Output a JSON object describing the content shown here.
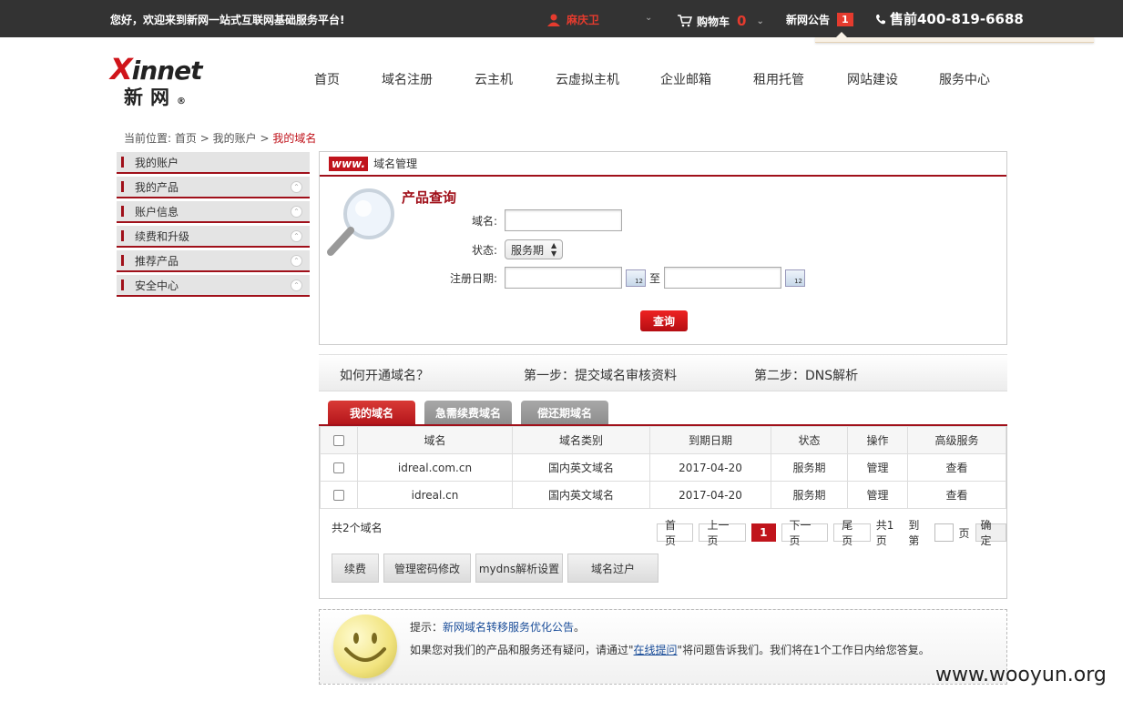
{
  "topbar": {
    "welcome": "您好，欢迎来到新网一站式互联网基础服务平台!",
    "user_name": "麻庆卫",
    "cart_label": "购物车",
    "cart_count": "0",
    "notice_label": "新网公告",
    "notice_count": "1",
    "phone": "售前400-819-6688"
  },
  "logo": {
    "en_x": "X",
    "en_rest": "innet",
    "cn": "新网",
    "reg": "®"
  },
  "nav": [
    "首页",
    "域名注册",
    "云主机",
    "云虚拟主机",
    "企业邮箱",
    "租用托管",
    "网站建设",
    "服务中心"
  ],
  "breadcrumb": {
    "prefix": "当前位置:",
    "home": "首页",
    "sep1": ">",
    "account": "我的账户",
    "sep2": ">",
    "current": "我的域名"
  },
  "sidebar": [
    "我的账户",
    "我的产品",
    "账户信息",
    "续费和升级",
    "推荐产品",
    "安全中心"
  ],
  "panel": {
    "www_badge": "www.",
    "title": "域名管理",
    "query_title": "产品查询",
    "domain_label": "域名:",
    "status_label": "状态:",
    "status_value": "服务期",
    "date_label": "注册日期:",
    "date_sep": "至",
    "calendar_day": "12",
    "search_btn": "查询"
  },
  "howto": {
    "question": "如何开通域名？",
    "step1": "第一步：提交域名审核资料",
    "step2": "第二步：DNS解析"
  },
  "tabs": [
    "我的域名",
    "急需续费域名",
    "偿还期域名"
  ],
  "table": {
    "headers": [
      "域名",
      "域名类别",
      "到期日期",
      "状态",
      "操作",
      "高级服务"
    ],
    "rows": [
      [
        "idreal.com.cn",
        "国内英文域名",
        "2017-04-20",
        "服务期",
        "管理",
        "查看"
      ],
      [
        "idreal.cn",
        "国内英文域名",
        "2017-04-20",
        "服务期",
        "管理",
        "查看"
      ]
    ]
  },
  "pager": {
    "total": "共2个域名",
    "first": "首页",
    "prev": "上一页",
    "current": "1",
    "next": "下一页",
    "last": "尾页",
    "pages_total": "共1页",
    "goto_prefix": "到第",
    "goto_suffix": "页",
    "confirm": "确定"
  },
  "actions": [
    "续费",
    "管理密码修改",
    "mydns解析设置",
    "域名过户"
  ],
  "tip": {
    "prefix": "提示：",
    "link": "新网域名转移服务优化公告",
    "end": "。",
    "line2_a": "如果您对我们的产品和服务还有疑问，请通过\"",
    "line2_link": "在线提问",
    "line2_b": "\"将问题告诉我们。我们将在1个工作日内给您答复。"
  },
  "watermark": "www.wooyun.org",
  "colors": {
    "accent": "#c0141c",
    "topbar": "#333333",
    "link": "#1a4d99"
  }
}
